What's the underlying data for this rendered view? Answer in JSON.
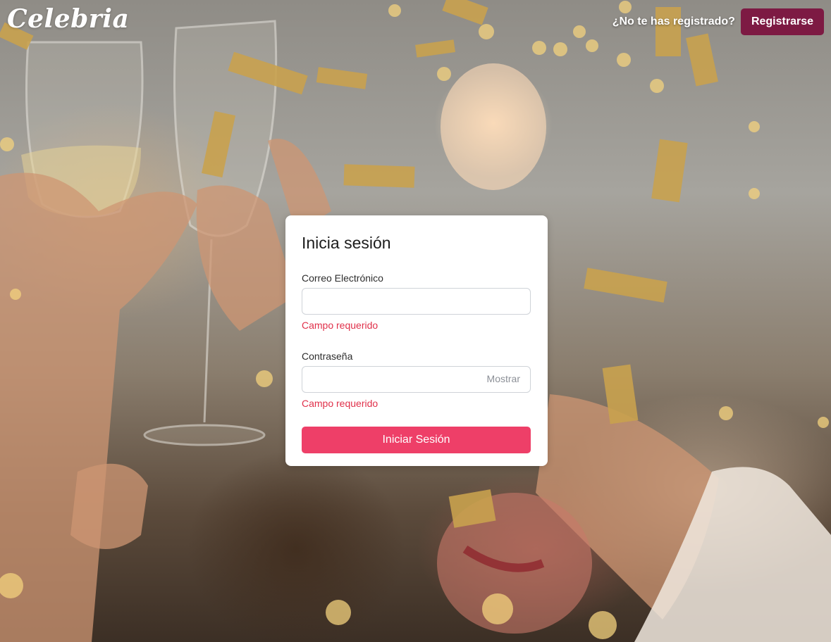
{
  "header": {
    "logo_text": "Celebria",
    "register_prompt": "¿No te has registrado?",
    "register_button": "Registrarse"
  },
  "login_form": {
    "title": "Inicia sesión",
    "email_label": "Correo Electrónico",
    "email_value": "",
    "email_error": "Campo requerido",
    "password_label": "Contraseña",
    "password_value": "",
    "password_toggle": "Mostrar",
    "password_error": "Campo requerido",
    "submit_button": "Iniciar Sesión"
  },
  "colors": {
    "register_button_bg": "#7d1a43",
    "submit_button_bg": "#ee3f68",
    "error_text": "#e0304a"
  },
  "background": {
    "description_icon": "party-photo"
  }
}
